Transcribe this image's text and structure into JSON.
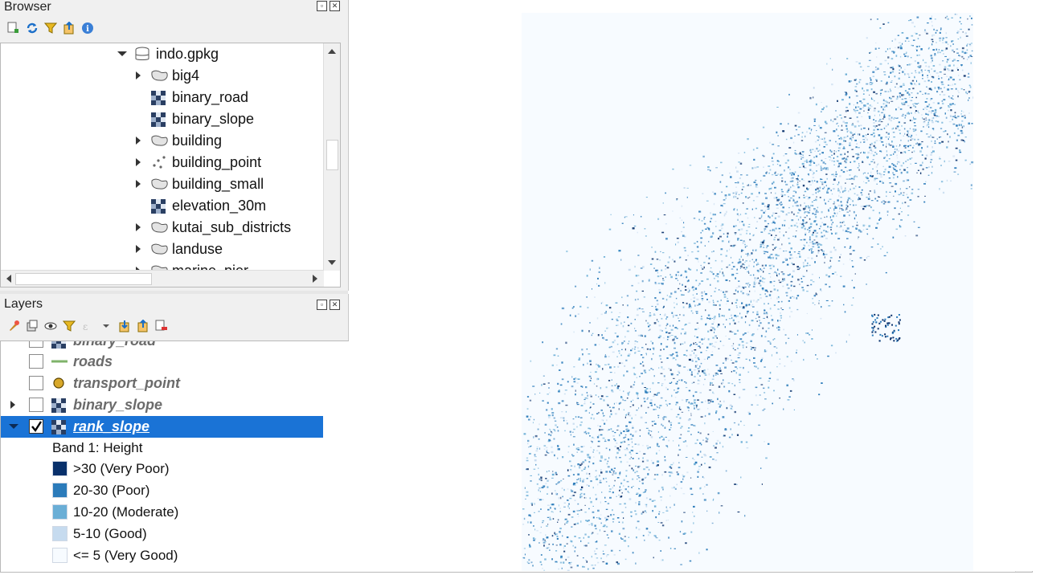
{
  "browser": {
    "title": "Browser",
    "items": [
      {
        "label": "indo.gpkg",
        "icon": "geopackage-icon"
      },
      {
        "label": "big4",
        "icon": "polygon-layer-icon"
      },
      {
        "label": "binary_road",
        "icon": "raster-layer-icon"
      },
      {
        "label": "binary_slope",
        "icon": "raster-layer-icon"
      },
      {
        "label": "building",
        "icon": "polygon-layer-icon"
      },
      {
        "label": "building_point",
        "icon": "point-layer-icon"
      },
      {
        "label": "building_small",
        "icon": "polygon-layer-icon"
      },
      {
        "label": "elevation_30m",
        "icon": "raster-layer-icon"
      },
      {
        "label": "kutai_sub_districts",
        "icon": "polygon-layer-icon"
      },
      {
        "label": "landuse",
        "icon": "polygon-layer-icon"
      },
      {
        "label": "marine_pier",
        "icon": "polygon-layer-icon"
      }
    ]
  },
  "layers": {
    "title": "Layers",
    "items": [
      {
        "label": "binary_road",
        "checked": false,
        "icon": "raster-layer-icon"
      },
      {
        "label": "roads",
        "checked": false,
        "icon": "line-layer-icon"
      },
      {
        "label": "transport_point",
        "checked": false,
        "icon": "point-layer-icon"
      },
      {
        "label": "binary_slope",
        "checked": false,
        "icon": "raster-layer-icon"
      },
      {
        "label": "rank_slope",
        "checked": true,
        "icon": "raster-layer-icon"
      }
    ],
    "legend": {
      "band": "Band 1: Height",
      "classes": [
        {
          "label": ">30 (Very Poor)",
          "color": "#08306b"
        },
        {
          "label": "20-30 (Poor)",
          "color": "#2b7bba"
        },
        {
          "label": "10-20 (Moderate)",
          "color": "#6aaed6"
        },
        {
          "label": "5-10 (Good)",
          "color": "#c6dbef"
        },
        {
          "label": "<= 5 (Very Good)",
          "color": "#f7fbff"
        }
      ]
    }
  },
  "colors": {
    "selection": "#1a73d6",
    "map_background": "#f7fbff"
  }
}
